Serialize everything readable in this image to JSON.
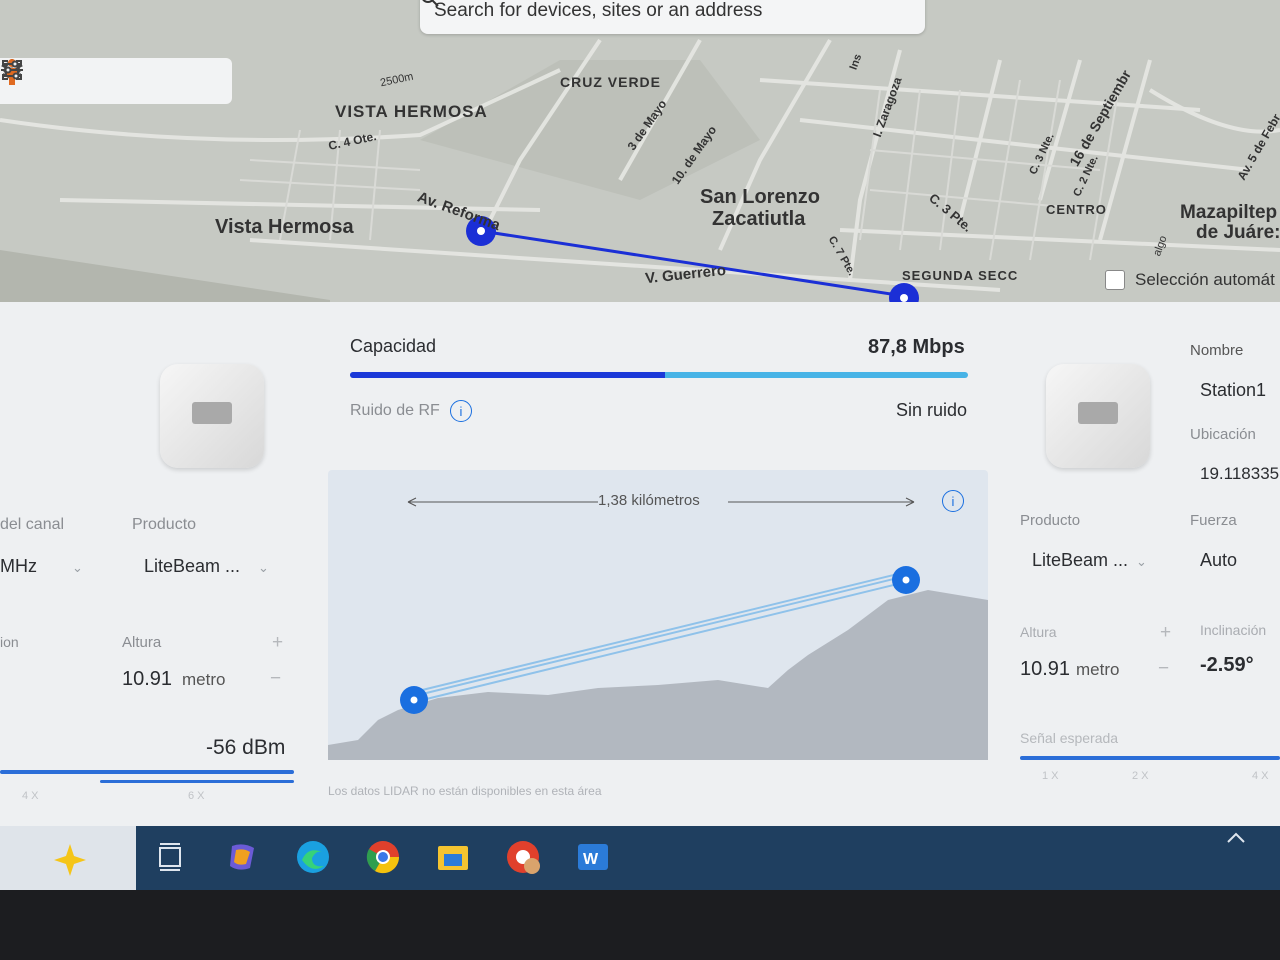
{
  "search": {
    "placeholder": "Search for devices, sites or an address"
  },
  "toolbar": {
    "icons": [
      "locate-icon",
      "fullscreen-icon",
      "layers-icon",
      "street-view-icon",
      "settings-sliders-icon"
    ]
  },
  "map": {
    "labels": {
      "vista_hermosa_upper": "VISTA HERMOSA",
      "cruz_verde": "CRUZ VERDE",
      "vista_hermosa": "Vista Hermosa",
      "san_lorenzo_1": "San Lorenzo",
      "san_lorenzo_2": "Zacatiutla",
      "centro": "CENTRO",
      "segunda_secc": "SEGUNDA SECC",
      "mazapiltep_1": "Mazapiltep",
      "mazapiltep_2": "de Juáre:",
      "av_reforma": "Av. Reforma",
      "c_4_ote": "C. 4 Ote.",
      "v_guerrero": "V. Guerrero",
      "tres_de_mayo": "3 de Mayo",
      "diez_de_mayo": "10. de Mayo",
      "zaragoza": "I. Zaragoza",
      "c3pte": "C. 3 Pte.",
      "c7pte": "C. 7 Pte.",
      "sixteen_sep": "16 de Septiembr",
      "c3nte": "C. 3 Nte.",
      "c2nte": "C. 2 Nte.",
      "av5feb": "Av. 5 de Febr",
      "ins": "Ins",
      "elev": "2500m",
      "algo": "algo"
    },
    "auto_select_label": "Selección automát"
  },
  "link": {
    "capacity_label": "Capacidad",
    "capacity_value": "87,8 Mbps",
    "capacity_fraction": 0.51,
    "rf_noise_label": "Ruido de RF",
    "rf_noise_value": "Sin ruido",
    "distance": "1,38 kilómetros",
    "lidar_note": "Los datos LIDAR no están disponibles en esta área"
  },
  "left_device": {
    "channel_label": "del canal",
    "channel_value": "MHz",
    "product_label": "Producto",
    "product_value": "LiteBeam ...",
    "cut_label": "ion",
    "height_label": "Altura",
    "height_value": "10.91",
    "height_unit": "metro",
    "signal_value": "-56 dBm",
    "scale": [
      "4 X",
      "6 X"
    ]
  },
  "right_device": {
    "name_label": "Nombre",
    "name_value": "Station1",
    "location_label": "Ubicación",
    "location_value": "19.118335,",
    "product_label": "Producto",
    "product_value": "LiteBeam ...",
    "power_label": "Fuerza",
    "power_value": "Auto",
    "height_label": "Altura",
    "height_value": "10.91",
    "height_unit": "metro",
    "tilt_label": "Inclinación",
    "tilt_value": "-2.59°",
    "expected_signal_label": "Señal esperada",
    "scale": [
      "1 X",
      "2 X",
      "4 X"
    ]
  },
  "colors": {
    "accent": "#1b39d8",
    "accent_light": "#47b3e6",
    "taskbar": "#1f3f60"
  },
  "taskbar": {
    "apps": [
      "copilot-sparkle-icon",
      "task-view-icon",
      "copilot-icon",
      "edge-icon",
      "chrome-icon",
      "file-explorer-icon",
      "chrome-profile-icon",
      "word-icon"
    ]
  }
}
